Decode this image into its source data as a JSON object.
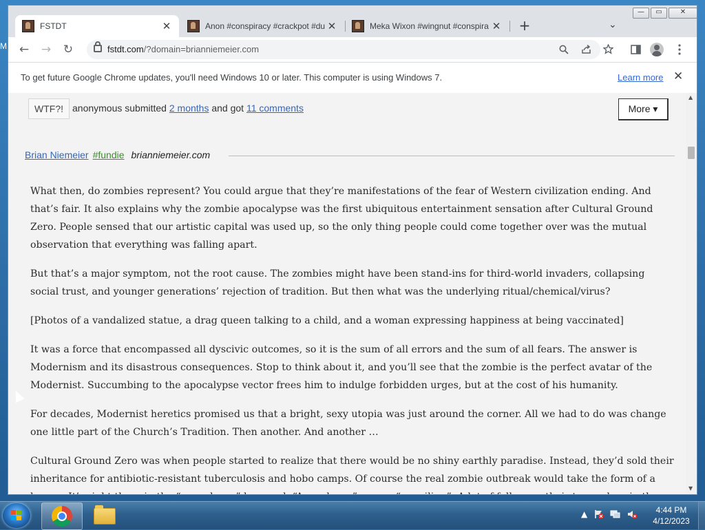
{
  "desktop": {
    "edge_text": "M"
  },
  "browser": {
    "tabs": [
      {
        "title": "FSTDT",
        "active": true
      },
      {
        "title": "Anon #conspiracy #crackpot #du",
        "active": false
      },
      {
        "title": "Meka Wixon #wingnut #conspira",
        "active": false
      }
    ],
    "new_tab_label": "+",
    "tab_search_label": "⌄",
    "window_controls": {
      "minimize": "—",
      "maximize": "▭",
      "close": "✕"
    },
    "toolbar": {
      "back": "←",
      "forward": "→",
      "reload": "↻"
    },
    "address": {
      "host": "fstdt.com",
      "path": "/?domain=brianniemeier.com"
    },
    "infobar": {
      "message": "To get future Google Chrome updates, you'll need Windows 10 or later. This computer is using Windows 7.",
      "link": "Learn more",
      "close": "✕"
    }
  },
  "page": {
    "rating_button": "WTF?!",
    "submission": {
      "submitter": "anonymous submitted",
      "time_link": "2 months",
      "middle": "and got",
      "comments_link": "11 comments"
    },
    "more_button": "More ▾",
    "meta": {
      "author": "Brian Niemeier",
      "tag": "#fundie",
      "domain": "brianniemeier.com"
    },
    "paragraphs": [
      "What then, do zombies represent? You could argue that they’re manifestations of the fear of Western civilization ending. And that’s fair. It also explains why the zombie apocalypse was the first ubiquitous entertainment sensation after Cultural Ground Zero. People sensed that our artistic capital was used up, so the only thing people could come together over was the mutual observation that everything was falling apart.",
      "But that’s a major symptom, not the root cause. The zombies might have been stand-ins for third-world invaders, collapsing social trust, and younger generations’ rejection of tradition. But then what was the underlying ritual/chemical/virus?",
      "[Photos of a vandalized statue, a drag queen talking to a child, and a woman expressing happiness at being vaccinated]",
      "It was a force that encompassed all dyscivic outcomes, so it is the sum of all errors and the sum of all fears. The answer is Modernism and its disastrous consequences. Stop to think about it, and you’ll see that the zombie is the perfect avatar of the Modernist. Succumbing to the apocalypse vector frees him to indulge forbidden urges, but at the cost of his humanity.",
      "For decades, Modernist heretics promised us that a bright, sexy utopia was just around the corner. All we had to do was change one little part of the Church’s Tradition. Then another. And another …",
      "Cultural Ground Zero was when people started to realize that there would be no shiny earthly paradise. Instead, they’d sold their inheritance for antibiotic-resistant tuberculosis and hobo camps. Of course the real zombie outbreak would take the form of a heresy. It’s right there in the “apocalypse” keyword. “Apocalypse” means “unveiling”. A lot of folks saw their true selves in those"
    ]
  },
  "taskbar": {
    "clock_time": "4:44 PM",
    "clock_date": "4/12/2023",
    "tray_show_hidden": "▲"
  },
  "colors": {
    "link": "#3366bb",
    "tag": "#3c8c2c",
    "content_bg": "#f3f3f3"
  }
}
